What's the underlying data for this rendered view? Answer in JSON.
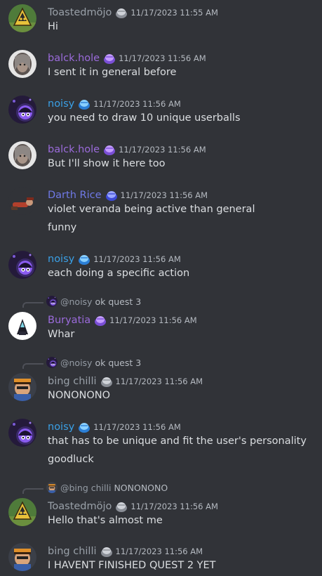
{
  "colors": {
    "background": "#313338",
    "text": "#dbdee1",
    "muted": "#b5bac1",
    "name_grey": "#99a0a8",
    "name_purple": "#9b6bdb",
    "name_blue": "#3aa0e6",
    "name_indigo": "#6f79e6"
  },
  "messages": [
    {
      "user": "Toastedmöjo",
      "name_color": "#99a0a8",
      "badge_icon": "grey-gem-icon",
      "timestamp": "11/17/2023 11:55 AM",
      "avatar_icon": "toasted-avatar-icon",
      "lines": [
        "Hi"
      ]
    },
    {
      "user": "balck.hole",
      "name_color": "#9b6bdb",
      "badge_icon": "purple-gem-icon",
      "timestamp": "11/17/2023 11:56 AM",
      "avatar_icon": "balck-avatar-icon",
      "lines": [
        "I sent it in general before"
      ]
    },
    {
      "user": "noisy",
      "name_color": "#3aa0e6",
      "badge_icon": "blue-gem-icon",
      "timestamp": "11/17/2023 11:56 AM",
      "avatar_icon": "noisy-avatar-icon",
      "lines": [
        "you need to draw 10 unique userballs"
      ]
    },
    {
      "user": "balck.hole",
      "name_color": "#9b6bdb",
      "badge_icon": "purple-gem-icon",
      "timestamp": "11/17/2023 11:56 AM",
      "avatar_icon": "balck-avatar-icon",
      "lines": [
        "But I'll show it here too"
      ]
    },
    {
      "user": "Darth Rice",
      "name_color": "#6f79e6",
      "badge_icon": "indigo-gem-icon",
      "timestamp": "11/17/2023 11:56 AM",
      "avatar_icon": "darth-avatar-icon",
      "lines": [
        "violet veranda being active than general",
        "funny"
      ]
    },
    {
      "user": "noisy",
      "name_color": "#3aa0e6",
      "badge_icon": "blue-gem-icon",
      "timestamp": "11/17/2023 11:56 AM",
      "avatar_icon": "noisy-avatar-icon",
      "lines": [
        "each doing a specific action"
      ]
    },
    {
      "reply": {
        "name": "@noisy",
        "text": "ok quest 3",
        "avatar_icon": "noisy-avatar-icon"
      },
      "user": "Buryatia",
      "name_color": "#9b6bdb",
      "badge_icon": "purple-gem-icon",
      "timestamp": "11/17/2023 11:56 AM",
      "avatar_icon": "buryatia-avatar-icon",
      "lines": [
        "Whar"
      ]
    },
    {
      "reply": {
        "name": "@noisy",
        "text": "ok quest 3",
        "avatar_icon": "noisy-avatar-icon"
      },
      "user": "bing chilli",
      "name_color": "#99a0a8",
      "badge_icon": "grey-gem-icon",
      "timestamp": "11/17/2023 11:56 AM",
      "avatar_icon": "bing-avatar-icon",
      "lines": [
        "NONONONO"
      ]
    },
    {
      "user": "noisy",
      "name_color": "#3aa0e6",
      "badge_icon": "blue-gem-icon",
      "timestamp": "11/17/2023 11:56 AM",
      "avatar_icon": "noisy-avatar-icon",
      "lines": [
        "that has to be unique and fit the user's personality",
        "goodluck"
      ]
    },
    {
      "reply": {
        "name": "@bing chilli",
        "text": "NONONONO",
        "avatar_icon": "bing-avatar-icon"
      },
      "user": "Toastedmöjo",
      "name_color": "#99a0a8",
      "badge_icon": "grey-gem-icon",
      "timestamp": "11/17/2023 11:56 AM",
      "avatar_icon": "toasted-avatar-icon",
      "lines": [
        "Hello that's almost me"
      ]
    },
    {
      "user": "bing chilli",
      "name_color": "#99a0a8",
      "badge_icon": "grey-gem-icon",
      "timestamp": "11/17/2023 11:56 AM",
      "avatar_icon": "bing-avatar-icon",
      "lines": [
        "I HAVENT FINISHED QUEST 2 YET"
      ]
    }
  ]
}
